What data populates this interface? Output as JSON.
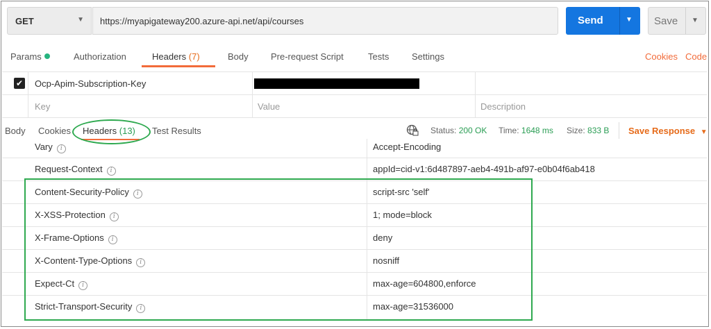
{
  "request": {
    "method": "GET",
    "url": "https://myapigateway200.azure-api.net/api/courses",
    "send_label": "Send",
    "save_label": "Save"
  },
  "request_tabs": {
    "params": "Params",
    "authorization": "Authorization",
    "headers": "Headers",
    "headers_count": "(7)",
    "body": "Body",
    "prerequest": "Pre-request Script",
    "tests": "Tests",
    "settings": "Settings",
    "cookies": "Cookies",
    "code": "Code"
  },
  "request_headers": {
    "row_key": "Ocp-Apim-Subscription-Key",
    "placeholder_key": "Key",
    "placeholder_value": "Value",
    "placeholder_description": "Description"
  },
  "response_tabs": {
    "body": "Body",
    "cookies": "Cookies",
    "headers": "Headers",
    "headers_count": "(13)",
    "test_results": "Test Results"
  },
  "response_status": {
    "status_label": "Status:",
    "status_value": "200 OK",
    "time_label": "Time:",
    "time_value": "1648 ms",
    "size_label": "Size:",
    "size_value": "833 B",
    "save_response": "Save Response"
  },
  "response_headers": [
    {
      "key": "Vary",
      "value": "Accept-Encoding"
    },
    {
      "key": "Request-Context",
      "value": "appId=cid-v1:6d487897-aeb4-491b-af97-e0b04f6ab418"
    },
    {
      "key": "Content-Security-Policy",
      "value": "script-src 'self'"
    },
    {
      "key": "X-XSS-Protection",
      "value": "1; mode=block"
    },
    {
      "key": "X-Frame-Options",
      "value": "deny"
    },
    {
      "key": "X-Content-Type-Options",
      "value": "nosniff"
    },
    {
      "key": "Expect-Ct",
      "value": "max-age=604800,enforce"
    },
    {
      "key": "Strict-Transport-Security",
      "value": "max-age=31536000"
    }
  ],
  "colors": {
    "send_blue": "#1476e0",
    "accent_orange": "#f26b3a",
    "status_green": "#2a9d54",
    "annotation_green": "#2ea94f"
  }
}
